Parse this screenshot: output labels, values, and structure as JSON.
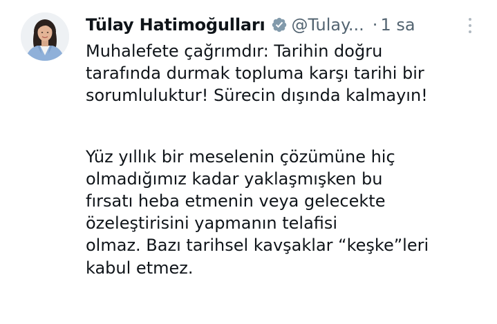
{
  "tweet": {
    "author": {
      "display_name": "Tülay Hatimoğulları",
      "handle": "@Tulay...",
      "verified_icon": "verified-badge-icon",
      "avatar_icon": "profile-photo"
    },
    "separator": "·",
    "timestamp": "1 sa",
    "more_icon": "more-options-icon",
    "paragraph_1": [
      "Muhalefete çağrımdır: Tarihin doğru",
      "tarafında durmak topluma karşı tarihi bir",
      "sorumluluktur! Sürecin dışında kalmayın!"
    ],
    "paragraph_2": [
      "Yüz yıllık bir meselenin çözümüne hiç",
      "olmadığımız kadar yaklaşmışken bu",
      "fırsatı heba etmenin veya gelecekte",
      "özeleştirisini yapmanın telafisi",
      "olmaz. Bazı tarihsel kavşaklar “keşke”leri",
      "kabul etmez."
    ],
    "colors": {
      "text": "#0f1419",
      "secondary": "#536471",
      "verified_badge": "#829aab"
    }
  }
}
